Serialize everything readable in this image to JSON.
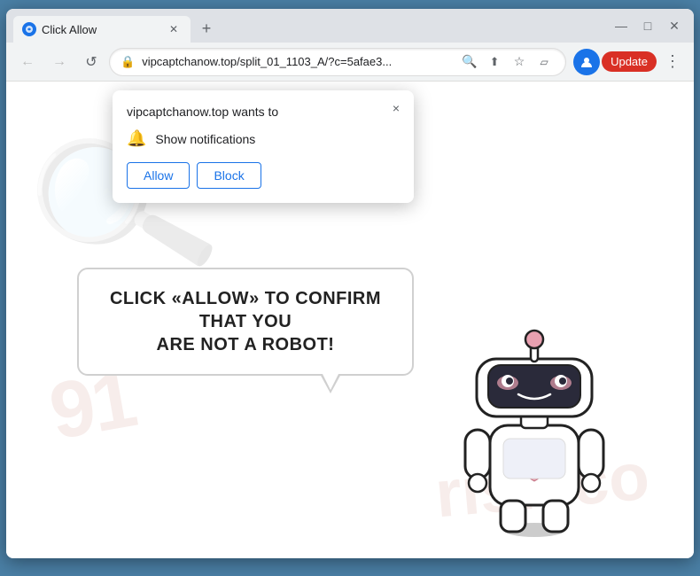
{
  "browser": {
    "title": "Click Allow",
    "url": "vipcaptchanow.top/split_01_1103_A/?c=5afae3...",
    "update_label": "Update",
    "new_tab_label": "+",
    "favicon_color": "#1a73e8"
  },
  "nav": {
    "back_label": "←",
    "forward_label": "→",
    "refresh_label": "↺",
    "lock_symbol": "🔒",
    "search_icon": "🔍",
    "share_icon": "⎋",
    "bookmark_icon": "☆",
    "split_icon": "▱",
    "profile_icon": "👤"
  },
  "popup": {
    "title": "vipcaptchanow.top wants to",
    "permission_label": "Show notifications",
    "allow_label": "Allow",
    "block_label": "Block",
    "close_label": "×"
  },
  "bubble": {
    "line1": "CLICK «ALLOW» TO CONFIRM THAT YOU",
    "line2": "ARE NOT A ROBOT!"
  },
  "watermarks": {
    "wm1": "91",
    "wm2": "risk.co"
  },
  "window_controls": {
    "minimize": "—",
    "maximize": "□",
    "close": "✕"
  }
}
